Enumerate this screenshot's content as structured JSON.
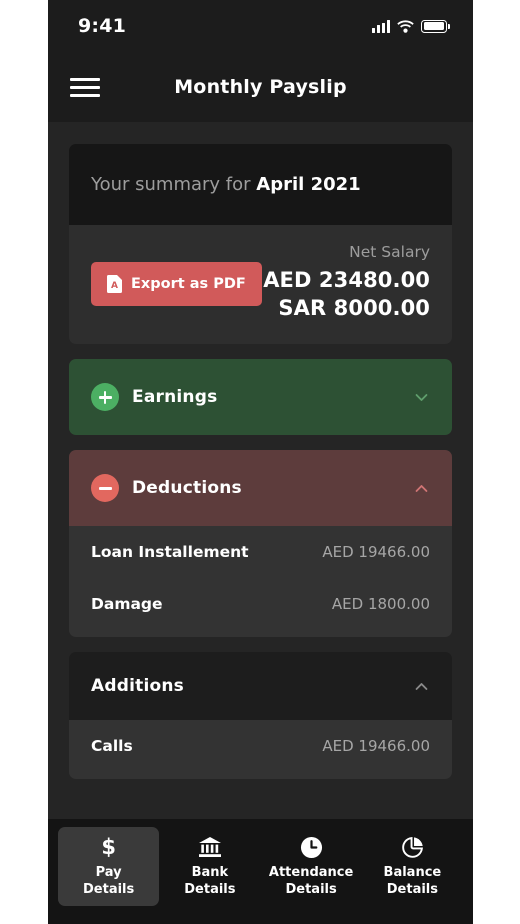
{
  "statusbar": {
    "time": "9:41",
    "signal_icon": "cellular-signal-icon",
    "wifi_icon": "wifi-icon",
    "battery_icon": "battery-icon"
  },
  "header": {
    "menu_icon": "hamburger-menu-icon",
    "title": "Monthly Payslip"
  },
  "summary": {
    "prefix": "Your summary for ",
    "period": "April 2021",
    "export_button": "Export as PDF",
    "export_icon": "pdf-file-icon",
    "net_salary_label": "Net Salary",
    "net_salary_primary": "AED 23480.00",
    "net_salary_secondary": "SAR 8000.00"
  },
  "sections": [
    {
      "id": "earnings",
      "title": "Earnings",
      "badge_icon": "plus-circle-icon",
      "chevron_icon": "chevron-down-icon",
      "expanded": false,
      "color": "#2d5134",
      "rows": []
    },
    {
      "id": "deductions",
      "title": "Deductions",
      "badge_icon": "minus-circle-icon",
      "chevron_icon": "chevron-up-icon",
      "expanded": true,
      "color": "#5d3c3c",
      "rows": [
        {
          "label": "Loan Installement",
          "value": "AED 19466.00"
        },
        {
          "label": "Damage",
          "value": "AED 1800.00"
        }
      ]
    },
    {
      "id": "additions",
      "title": "Additions",
      "badge_icon": "",
      "chevron_icon": "chevron-up-icon",
      "expanded": true,
      "color": "#1d1d1d",
      "rows": [
        {
          "label": "Calls",
          "value": "AED 19466.00"
        }
      ]
    }
  ],
  "bottom_nav": {
    "active_index": 0,
    "items": [
      {
        "icon": "dollar-sign-icon",
        "glyph": "$",
        "line1": "Pay",
        "line2": "Details"
      },
      {
        "icon": "bank-icon",
        "glyph": "bank",
        "line1": "Bank",
        "line2": "Details"
      },
      {
        "icon": "clock-icon",
        "glyph": "clock",
        "line1": "Attendance",
        "line2": "Details"
      },
      {
        "icon": "pie-chart-icon",
        "glyph": "pie",
        "line1": "Balance",
        "line2": "Details"
      }
    ]
  },
  "colors": {
    "page_bg": "#252525",
    "bar_bg": "#1c1c1c",
    "accent_red": "#d15a5a",
    "earnings_green": "#2d5134",
    "deductions_red": "#5d3c3c",
    "row_bg": "#333333"
  }
}
